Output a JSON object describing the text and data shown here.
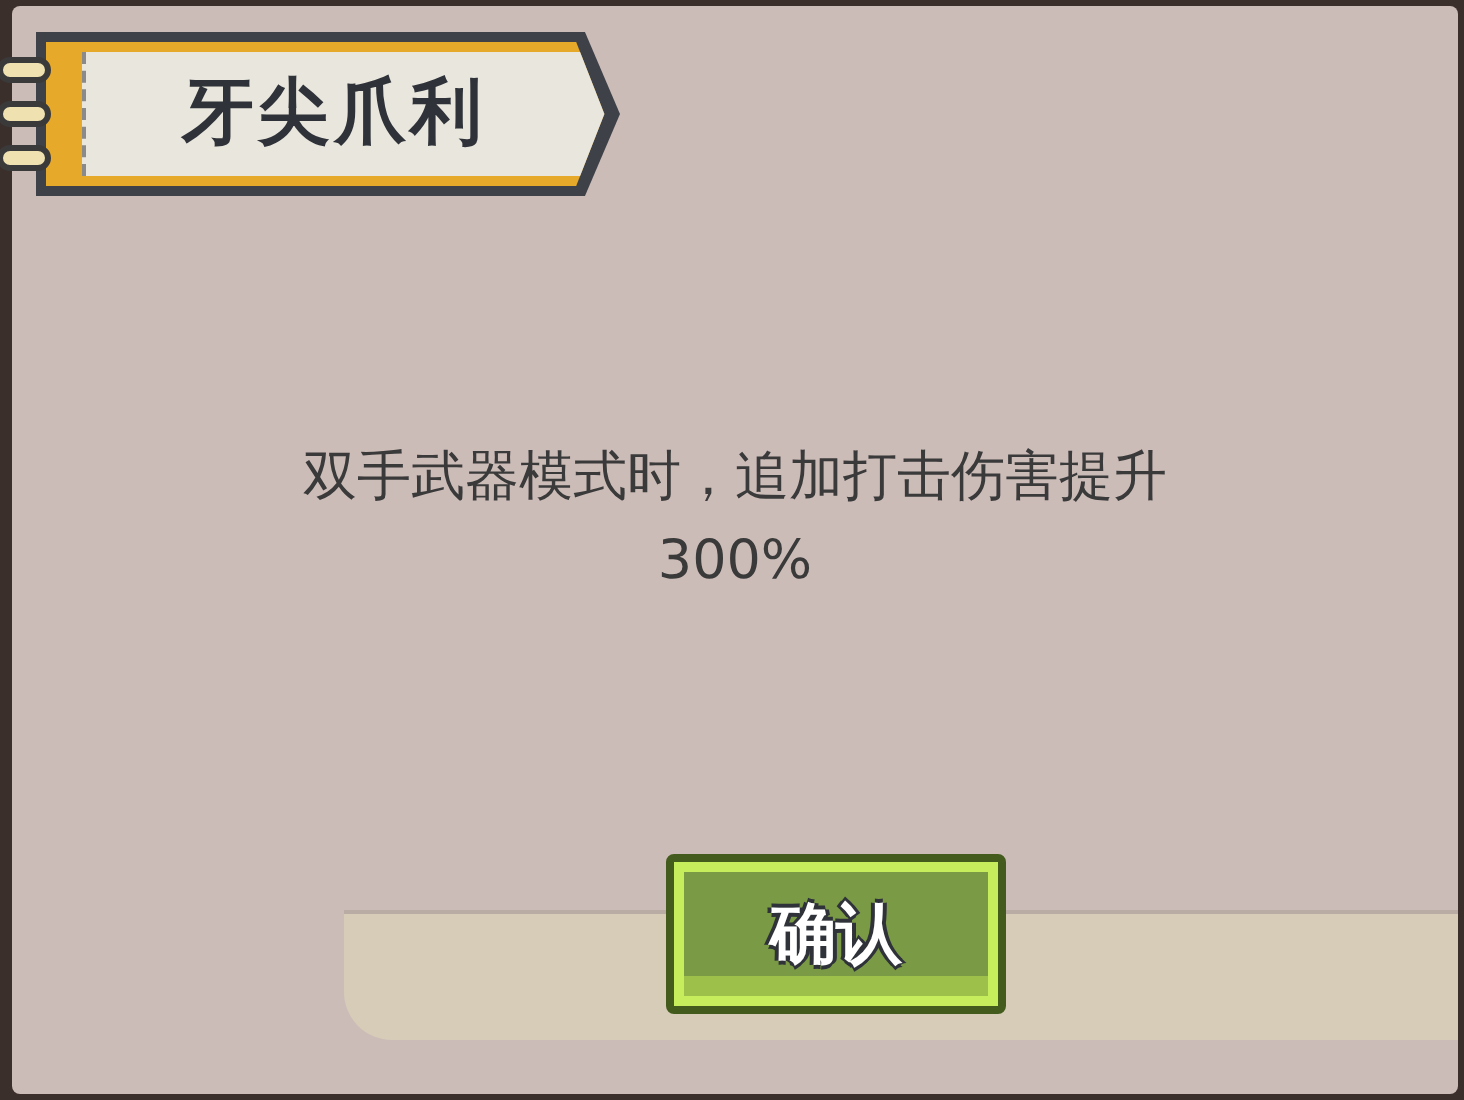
{
  "dialog": {
    "title": "牙尖爪利",
    "description_lines": [
      "双手武器模式时，追加打击伤害提升",
      "300%"
    ],
    "confirm_button": "确认"
  }
}
